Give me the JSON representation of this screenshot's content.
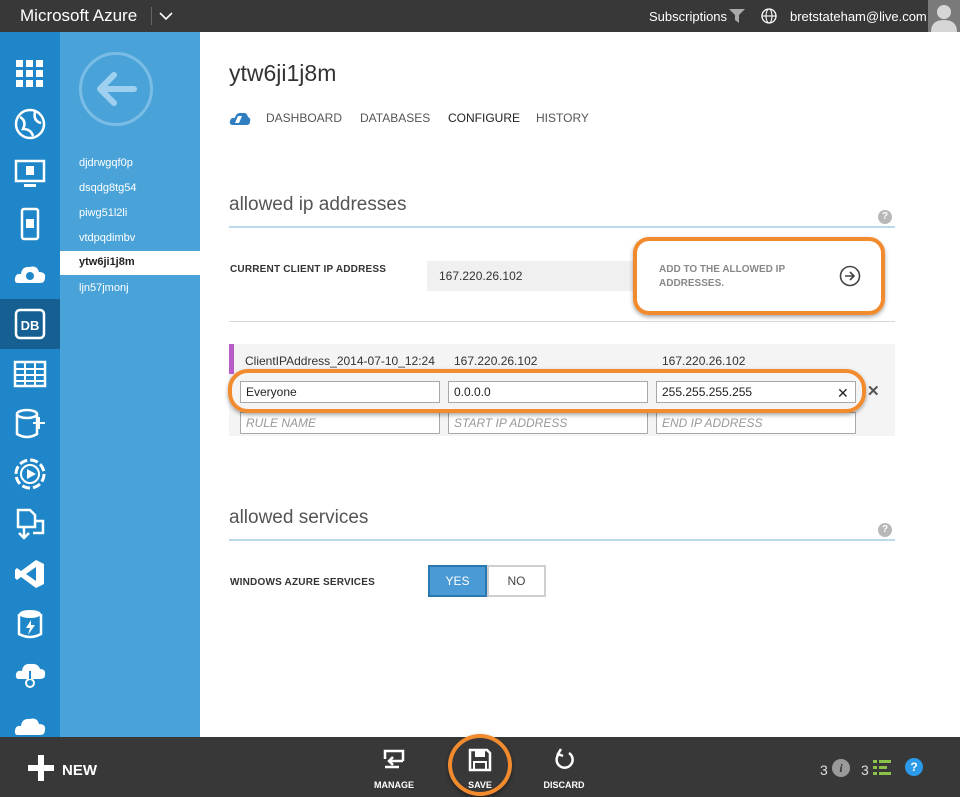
{
  "topbar": {
    "brand": "Microsoft Azure",
    "subscriptions": "Subscriptions",
    "user_email": "bretstateham@live.com"
  },
  "rail": {
    "items": [
      {
        "icon": "all-items-grid-icon"
      },
      {
        "icon": "web-sites-icon"
      },
      {
        "icon": "virtual-machines-icon"
      },
      {
        "icon": "mobile-services-icon"
      },
      {
        "icon": "cloud-services-icon"
      },
      {
        "icon": "sql-databases-icon",
        "label": "DB",
        "active": true
      },
      {
        "icon": "storage-table-icon"
      },
      {
        "icon": "hdinsight-icon"
      },
      {
        "icon": "media-services-icon"
      },
      {
        "icon": "service-bus-icon"
      },
      {
        "icon": "visual-studio-icon"
      },
      {
        "icon": "cache-icon"
      },
      {
        "icon": "networks-icon"
      },
      {
        "icon": "cloud-icon"
      }
    ]
  },
  "sidebar": {
    "items": [
      {
        "label": "djdrwgqf0p"
      },
      {
        "label": "dsqdg8tg54"
      },
      {
        "label": "piwg51l2li"
      },
      {
        "label": "vtdpqdimbv"
      },
      {
        "label": "ytw6ji1j8m",
        "active": true
      },
      {
        "label": "ljn57jmonj"
      }
    ]
  },
  "main": {
    "title": "ytw6ji1j8m",
    "tabs": [
      {
        "label": "DASHBOARD"
      },
      {
        "label": "DATABASES"
      },
      {
        "label": "CONFIGURE",
        "active": true
      },
      {
        "label": "HISTORY"
      }
    ],
    "allowed_ip": {
      "heading": "allowed ip addresses",
      "help": "?",
      "current_client_label": "CURRENT CLIENT IP ADDRESS",
      "current_client_ip": "167.220.26.102",
      "add_button_label": "ADD TO THE ALLOWED IP ADDRESSES.",
      "existing_rule": {
        "name": "ClientIPAddress_2014-07-10_12:24",
        "start": "167.220.26.102",
        "end": "167.220.26.102"
      },
      "edit_rule": {
        "name": "Everyone",
        "start": "0.0.0.0",
        "end": "255.255.255.255"
      },
      "placeholders": {
        "name": "RULE NAME",
        "start": "START IP ADDRESS",
        "end": "END IP ADDRESS"
      }
    },
    "allowed_services": {
      "heading": "allowed services",
      "help": "?",
      "windows_azure_label": "WINDOWS AZURE SERVICES",
      "yes": "YES",
      "no": "NO",
      "selected": "YES"
    }
  },
  "bottombar": {
    "new_label": "NEW",
    "commands": [
      {
        "label": "MANAGE",
        "icon": "manage-icon"
      },
      {
        "label": "SAVE",
        "icon": "save-icon"
      },
      {
        "label": "DISCARD",
        "icon": "discard-icon"
      }
    ],
    "info_count": "3",
    "progress_count": "3",
    "info_glyph": "i",
    "help_glyph": "?"
  },
  "colors": {
    "topbar": "#383838",
    "rail": "#1e86c9",
    "sidebar": "#4aa3d8",
    "highlight": "#f28a2e",
    "toggle_selected": "#4a9ad6"
  }
}
